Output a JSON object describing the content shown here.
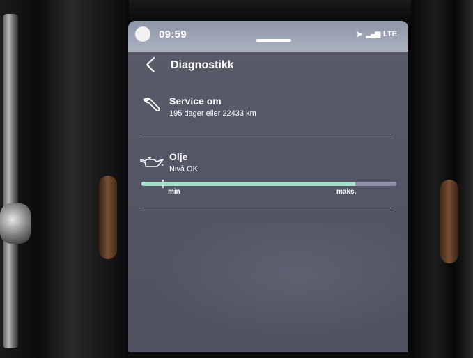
{
  "status_bar": {
    "time": "09:59",
    "network": "LTE",
    "icons": [
      "navigation-arrow-icon",
      "signal-bars-icon"
    ]
  },
  "header": {
    "title": "Diagnostikk",
    "back_icon": "chevron-left-icon"
  },
  "service": {
    "icon": "wrench-icon",
    "title": "Service om",
    "subtitle": "195 dager eller 22433 km"
  },
  "oil": {
    "icon": "oil-can-icon",
    "title": "Olje",
    "subtitle": "Nivå OK",
    "level_fraction": 0.84,
    "min_label": "min",
    "max_label": "maks.",
    "fill_color": "#a4e2c9",
    "track_color": "#8d93ad"
  }
}
